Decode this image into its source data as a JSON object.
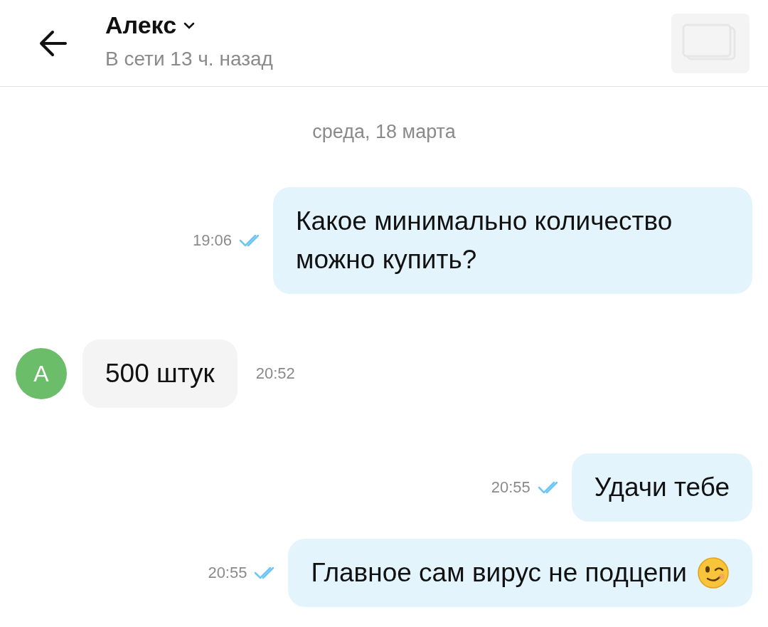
{
  "header": {
    "name": "Алекс",
    "status": "В сети 13 ч. назад"
  },
  "date_separator": "среда, 18 марта",
  "messages": [
    {
      "kind": "outgoing",
      "text": "Какое минимально количество можно купить?",
      "time": "19:06",
      "read": true
    },
    {
      "kind": "incoming",
      "avatar": "А",
      "text": "500 штук",
      "time": "20:52"
    },
    {
      "kind": "outgoing",
      "text": "Удачи тебе",
      "time": "20:55",
      "read": true
    },
    {
      "kind": "outgoing",
      "text": "Главное сам вирус не подцепи",
      "winking_emoji": true,
      "time": "20:55",
      "read": true
    }
  ]
}
